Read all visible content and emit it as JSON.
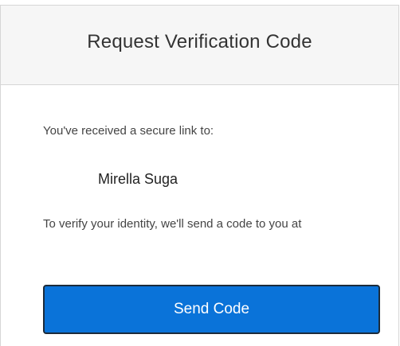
{
  "header": {
    "title": "Request Verification Code"
  },
  "body": {
    "received_text": "You've received a secure link to:",
    "recipient_name": "Mirella Suga",
    "verify_text": "To verify your identity, we'll send a code to you at"
  },
  "actions": {
    "send_code_label": "Send Code"
  },
  "colors": {
    "primary_button": "#0a73d9",
    "header_bg": "#f6f6f6",
    "border": "#d6d6d6"
  }
}
